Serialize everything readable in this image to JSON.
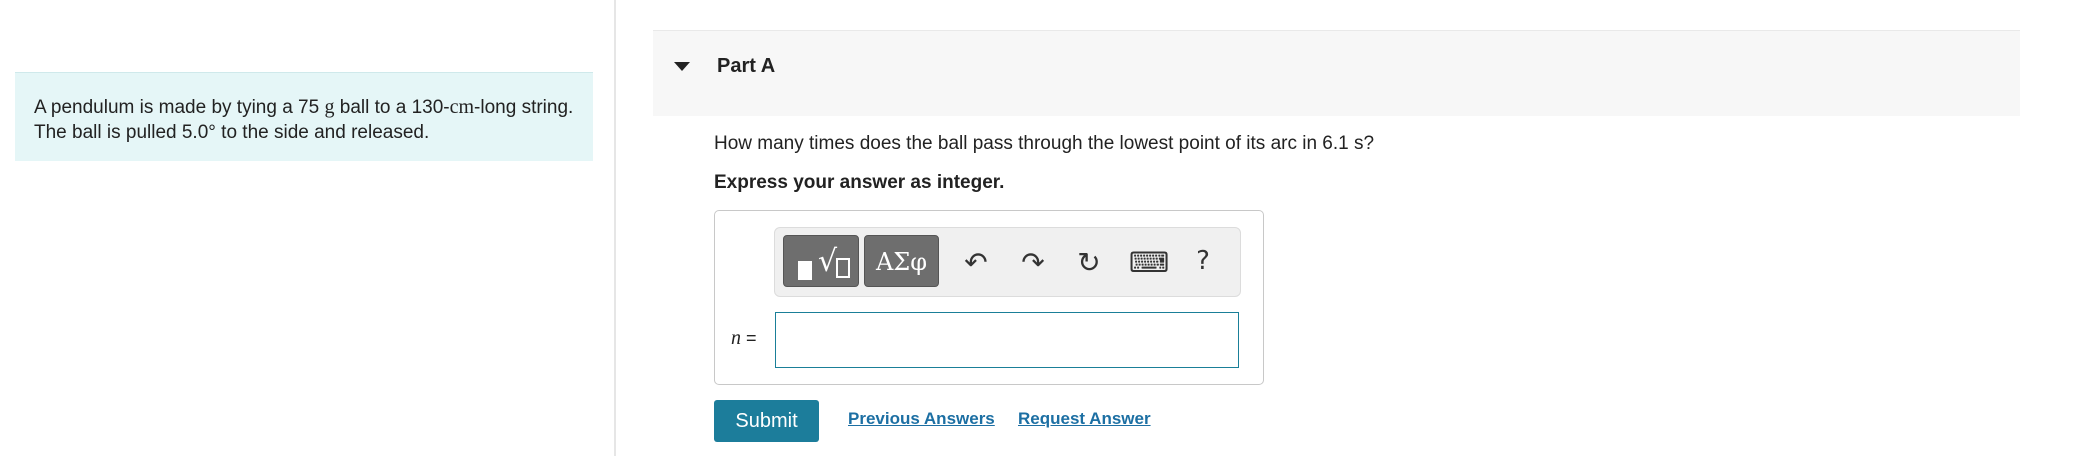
{
  "problem": {
    "text_1": "A pendulum is made by tying a 75 ",
    "unit_g": "g",
    "text_2": " ball to a 130-",
    "unit_cm": "cm",
    "text_3": "-long string. The ball is pulled 5.0",
    "degree": "°",
    "text_4": "  to the side and released."
  },
  "part": {
    "title": "Part A",
    "question": "How many times does the ball pass through the lowest point of its arc in 6.1 s?",
    "instruction": "Express your answer as integer."
  },
  "toolbar": {
    "templates_icon": "templates-icon",
    "symbols_label": "ΑΣφ",
    "undo_glyph": "↶",
    "redo_glyph": "↷",
    "reset_glyph": "↻",
    "keyboard_glyph": "⌨",
    "help_glyph": "?"
  },
  "answer": {
    "variable": "n",
    "equals": " =",
    "value": ""
  },
  "actions": {
    "submit_label": "Submit",
    "previous_answers_label": "Previous Answers",
    "request_answer_label": "Request Answer"
  },
  "colors": {
    "accent": "#1c7d9b",
    "problem_bg": "#e5f6f7",
    "link": "#1c6fa3"
  }
}
